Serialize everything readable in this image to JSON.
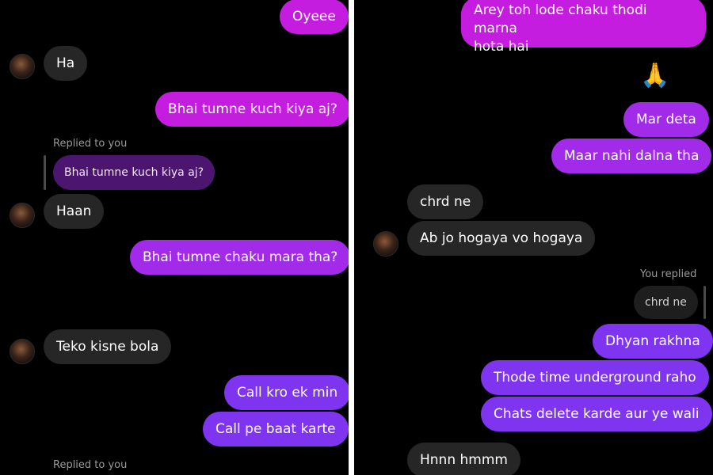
{
  "left_chat": {
    "messages": {
      "oyeee": "Oyeee",
      "ha": "Ha",
      "kuch_kiya": "Bhai tumne kuch kiya aj?",
      "replied_label": "Replied to you",
      "replied_quote": "Bhai tumne kuch kiya aj?",
      "haan": "Haan",
      "chaku_mara": "Bhai tumne chaku mara tha?",
      "crying_emoji": "😭",
      "teko_kisne": "Teko kisne bola",
      "call_kro": "Call kro ek min",
      "call_pe": "Call pe baat karte",
      "replied_label_2": "Replied to you"
    }
  },
  "right_chat": {
    "messages": {
      "arey_line1": "Arey toh lode chaku thodi marna",
      "arey_line2": "hota hai",
      "pray_cry_emoji": "🙏😭",
      "mar_deta": "Mar deta",
      "maar_nahi": "Maar nahi dalna tha",
      "chrd_ne": "chrd ne",
      "ab_jo": "Ab jo hogaya vo hogaya",
      "you_replied_label": "You replied",
      "you_replied_quote": "chrd ne",
      "dhyan": "Dhyan rakhna",
      "thode_time": "Thode time underground raho",
      "chats_delete": "Chats delete karde aur ye wali",
      "hnnn": "Hnnn hmmm"
    }
  }
}
